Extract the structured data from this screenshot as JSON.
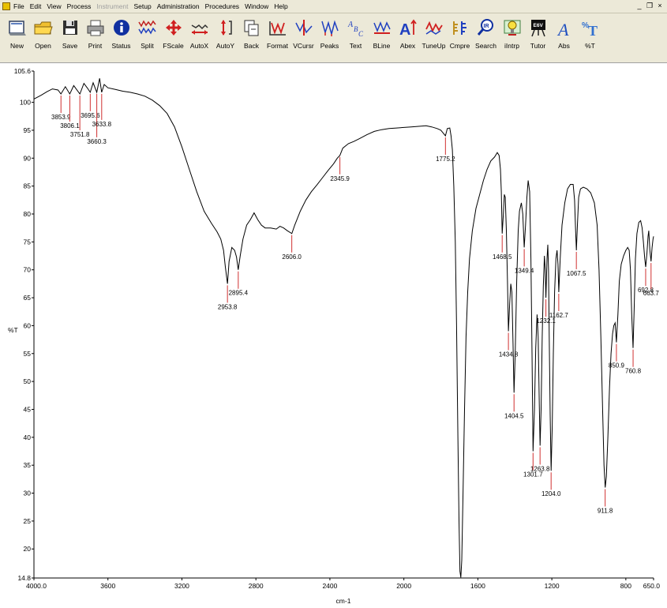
{
  "menubar": {
    "items": [
      {
        "label": "File",
        "enabled": true
      },
      {
        "label": "Edit",
        "enabled": true
      },
      {
        "label": "View",
        "enabled": true
      },
      {
        "label": "Process",
        "enabled": true
      },
      {
        "label": "Instrument",
        "enabled": false
      },
      {
        "label": "Setup",
        "enabled": true
      },
      {
        "label": "Administration",
        "enabled": true
      },
      {
        "label": "Procedures",
        "enabled": true
      },
      {
        "label": "Window",
        "enabled": true
      },
      {
        "label": "Help",
        "enabled": true
      }
    ],
    "window_controls": {
      "minimize": "_",
      "restore": "❐",
      "close": "×"
    }
  },
  "toolbar": {
    "buttons": [
      {
        "label": "New",
        "icon": "new-document-icon"
      },
      {
        "label": "Open",
        "icon": "open-folder-icon"
      },
      {
        "label": "Save",
        "icon": "floppy-disk-icon"
      },
      {
        "label": "Print",
        "icon": "printer-icon"
      },
      {
        "label": "Status",
        "icon": "info-icon"
      },
      {
        "label": "Split",
        "icon": "split-spectrum-icon"
      },
      {
        "label": "FScale",
        "icon": "full-scale-arrows-icon"
      },
      {
        "label": "AutoX",
        "icon": "auto-x-icon"
      },
      {
        "label": "AutoY",
        "icon": "auto-y-icon"
      },
      {
        "label": "Back",
        "icon": "back-pages-icon"
      },
      {
        "label": "Format",
        "icon": "format-icon"
      },
      {
        "label": "VCursr",
        "icon": "vertical-cursor-icon"
      },
      {
        "label": "Peaks",
        "icon": "peaks-icon"
      },
      {
        "label": "Text",
        "icon": "text-abc-icon"
      },
      {
        "label": "BLine",
        "icon": "baseline-icon"
      },
      {
        "label": "Abex",
        "icon": "abex-icon"
      },
      {
        "label": "TuneUp",
        "icon": "tune-up-icon"
      },
      {
        "label": "Cmpre",
        "icon": "compare-icon"
      },
      {
        "label": "Search",
        "icon": "search-ir-icon"
      },
      {
        "label": "iIntrp",
        "icon": "interpret-bulb-icon"
      },
      {
        "label": "Tutor",
        "icon": "tutor-easel-icon"
      },
      {
        "label": "Abs",
        "icon": "absorbance-icon"
      },
      {
        "label": "%T",
        "icon": "percent-transmittance-icon"
      }
    ],
    "tutor_icon_text": "E6V",
    "text_icon_glyphs": "ABC"
  },
  "chart_data": {
    "type": "line",
    "title": "",
    "xlabel": "cm-1",
    "ylabel": "%T",
    "xlim": [
      4000.0,
      650.0
    ],
    "ylim": [
      14.8,
      105.6
    ],
    "x_ticks": [
      "4000.0",
      "3600",
      "3200",
      "2800",
      "2400",
      "2000",
      "1600",
      "1200",
      "800",
      "650.0"
    ],
    "x_tick_values": [
      4000,
      3600,
      3200,
      2800,
      2400,
      2000,
      1600,
      1200,
      800,
      650
    ],
    "y_ticks": [
      "105.6",
      "100",
      "95",
      "90",
      "85",
      "80",
      "75",
      "70",
      "65",
      "60",
      "55",
      "50",
      "45",
      "40",
      "35",
      "30",
      "25",
      "20",
      "14.8"
    ],
    "y_tick_values": [
      105.6,
      100,
      95,
      90,
      85,
      80,
      75,
      70,
      65,
      60,
      55,
      50,
      45,
      40,
      35,
      30,
      25,
      20,
      14.8
    ],
    "grid": false,
    "colors": {
      "trace": "#000000",
      "peak_marker": "#d03030",
      "axis": "#000000"
    },
    "peak_labels": [
      {
        "x": 3853.9,
        "y": 101.5,
        "label": "3853.9",
        "level": 0
      },
      {
        "x": 3806.1,
        "y": 101.5,
        "label": "3806.1",
        "level": 1
      },
      {
        "x": 3751.8,
        "y": 101.5,
        "label": "3751.8",
        "level": 2
      },
      {
        "x": 3695.6,
        "y": 101.8,
        "label": "3695.6",
        "level": 0
      },
      {
        "x": 3660.3,
        "y": 101.8,
        "label": "3660.3",
        "level": 3
      },
      {
        "x": 3633.8,
        "y": 101.8,
        "label": "3633.8",
        "level": 1
      },
      {
        "x": 2953.8,
        "y": 67.5,
        "label": "2953.8",
        "level": 0
      },
      {
        "x": 2895.4,
        "y": 70.0,
        "label": "2895.4",
        "level": 0
      },
      {
        "x": 2606.0,
        "y": 76.5,
        "label": "2606.0",
        "level": 0
      },
      {
        "x": 2345.9,
        "y": 90.5,
        "label": "2345.9",
        "level": 0
      },
      {
        "x": 1775.2,
        "y": 94.0,
        "label": "1775.2",
        "level": 0
      },
      {
        "x": 1468.5,
        "y": 76.5,
        "label": "1468.5",
        "level": 0
      },
      {
        "x": 1434.8,
        "y": 59.0,
        "label": "1434.8",
        "level": 0
      },
      {
        "x": 1404.5,
        "y": 48.0,
        "label": "1404.5",
        "level": 0
      },
      {
        "x": 1349.4,
        "y": 74.0,
        "label": "1349.4",
        "level": 0
      },
      {
        "x": 1301.7,
        "y": 37.5,
        "label": "1301.7",
        "level": 0
      },
      {
        "x": 1263.8,
        "y": 38.5,
        "label": "1263.8",
        "level": 0
      },
      {
        "x": 1232.1,
        "y": 65.0,
        "label": "1232.1",
        "level": 0
      },
      {
        "x": 1204.0,
        "y": 34.0,
        "label": "1204.0",
        "level": 0
      },
      {
        "x": 1162.7,
        "y": 66.0,
        "label": "1162.7",
        "level": 0
      },
      {
        "x": 1067.5,
        "y": 73.5,
        "label": "1067.5",
        "level": 0
      },
      {
        "x": 911.8,
        "y": 31.0,
        "label": "911.8",
        "level": 0
      },
      {
        "x": 850.9,
        "y": 57.0,
        "label": "850.9",
        "level": 0
      },
      {
        "x": 760.8,
        "y": 56.0,
        "label": "760.8",
        "level": 0
      },
      {
        "x": 692.8,
        "y": 70.5,
        "label": "692.8",
        "level": 0
      },
      {
        "x": 663.7,
        "y": 71.5,
        "label": "663.7",
        "level": 1
      }
    ],
    "series": [
      {
        "values": [
          [
            4000,
            100.6
          ],
          [
            3960,
            101.3
          ],
          [
            3930,
            101.9
          ],
          [
            3900,
            102.4
          ],
          [
            3870,
            102.2
          ],
          [
            3853.9,
            101.5
          ],
          [
            3830,
            102.8
          ],
          [
            3806.1,
            101.5
          ],
          [
            3785,
            103.0
          ],
          [
            3751.8,
            101.5
          ],
          [
            3730,
            103.4
          ],
          [
            3710,
            102.5
          ],
          [
            3695.6,
            101.8
          ],
          [
            3680,
            103.5
          ],
          [
            3660.3,
            101.8
          ],
          [
            3645,
            104.3
          ],
          [
            3633.8,
            101.8
          ],
          [
            3620,
            103.2
          ],
          [
            3600,
            102.6
          ],
          [
            3560,
            102.3
          ],
          [
            3520,
            102.0
          ],
          [
            3480,
            101.8
          ],
          [
            3440,
            101.5
          ],
          [
            3400,
            101.1
          ],
          [
            3360,
            100.4
          ],
          [
            3320,
            99.4
          ],
          [
            3280,
            98.0
          ],
          [
            3240,
            95.6
          ],
          [
            3200,
            92.0
          ],
          [
            3160,
            88.0
          ],
          [
            3120,
            84.0
          ],
          [
            3080,
            80.5
          ],
          [
            3040,
            78.3
          ],
          [
            3010,
            76.8
          ],
          [
            2990,
            75.5
          ],
          [
            2975,
            73.5
          ],
          [
            2965,
            70.5
          ],
          [
            2953.8,
            67.5
          ],
          [
            2945,
            71.5
          ],
          [
            2930,
            74.0
          ],
          [
            2915,
            73.5
          ],
          [
            2905,
            72.3
          ],
          [
            2895.4,
            70.0
          ],
          [
            2885,
            72.5
          ],
          [
            2870,
            75.5
          ],
          [
            2850,
            78.0
          ],
          [
            2830,
            79.0
          ],
          [
            2810,
            80.2
          ],
          [
            2790,
            79.0
          ],
          [
            2770,
            78.0
          ],
          [
            2750,
            77.5
          ],
          [
            2720,
            77.5
          ],
          [
            2690,
            77.3
          ],
          [
            2670,
            77.8
          ],
          [
            2650,
            77.5
          ],
          [
            2630,
            77.0
          ],
          [
            2606.0,
            76.5
          ],
          [
            2590,
            78.0
          ],
          [
            2560,
            80.5
          ],
          [
            2530,
            82.5
          ],
          [
            2500,
            84.0
          ],
          [
            2470,
            85.2
          ],
          [
            2440,
            86.5
          ],
          [
            2410,
            87.8
          ],
          [
            2380,
            89.0
          ],
          [
            2360,
            90.0
          ],
          [
            2345.9,
            90.5
          ],
          [
            2330,
            91.8
          ],
          [
            2300,
            92.6
          ],
          [
            2270,
            93.0
          ],
          [
            2240,
            93.5
          ],
          [
            2200,
            94.2
          ],
          [
            2160,
            94.8
          ],
          [
            2120,
            95.1
          ],
          [
            2080,
            95.3
          ],
          [
            2040,
            95.4
          ],
          [
            2000,
            95.5
          ],
          [
            1960,
            95.6
          ],
          [
            1920,
            95.7
          ],
          [
            1880,
            95.8
          ],
          [
            1850,
            95.6
          ],
          [
            1820,
            95.3
          ],
          [
            1800,
            95.0
          ],
          [
            1790,
            94.6
          ],
          [
            1775.2,
            94.0
          ],
          [
            1765,
            95.3
          ],
          [
            1752,
            95.4
          ],
          [
            1745,
            94.0
          ],
          [
            1738,
            91.5
          ],
          [
            1730,
            85.0
          ],
          [
            1722,
            75.0
          ],
          [
            1715,
            60.0
          ],
          [
            1708,
            40.0
          ],
          [
            1702,
            25.0
          ],
          [
            1697,
            16.0
          ],
          [
            1692,
            14.9
          ],
          [
            1687,
            18.0
          ],
          [
            1680,
            30.0
          ],
          [
            1672,
            45.0
          ],
          [
            1664,
            58.0
          ],
          [
            1655,
            66.0
          ],
          [
            1645,
            72.0
          ],
          [
            1630,
            77.0
          ],
          [
            1610,
            81.0
          ],
          [
            1590,
            83.5
          ],
          [
            1570,
            86.0
          ],
          [
            1550,
            88.0
          ],
          [
            1530,
            89.5
          ],
          [
            1510,
            90.2
          ],
          [
            1495,
            91.0
          ],
          [
            1485,
            90.5
          ],
          [
            1478,
            88.0
          ],
          [
            1473,
            84.0
          ],
          [
            1468.5,
            76.5
          ],
          [
            1462,
            80.0
          ],
          [
            1457,
            83.5
          ],
          [
            1452,
            83.0
          ],
          [
            1446,
            77.0
          ],
          [
            1440,
            68.0
          ],
          [
            1434.8,
            59.0
          ],
          [
            1428,
            64.0
          ],
          [
            1422,
            67.5
          ],
          [
            1416,
            66.0
          ],
          [
            1410,
            57.0
          ],
          [
            1404.5,
            48.0
          ],
          [
            1398,
            55.0
          ],
          [
            1390,
            68.0
          ],
          [
            1382,
            77.0
          ],
          [
            1375,
            80.5
          ],
          [
            1365,
            82.0
          ],
          [
            1357,
            80.0
          ],
          [
            1349.4,
            74.0
          ],
          [
            1342,
            78.0
          ],
          [
            1335,
            83.0
          ],
          [
            1328,
            86.0
          ],
          [
            1320,
            84.0
          ],
          [
            1313,
            72.0
          ],
          [
            1307,
            55.0
          ],
          [
            1301.7,
            37.5
          ],
          [
            1294,
            45.0
          ],
          [
            1287,
            56.0
          ],
          [
            1280,
            62.0
          ],
          [
            1274,
            58.0
          ],
          [
            1268,
            46.0
          ],
          [
            1263.8,
            38.5
          ],
          [
            1258,
            45.0
          ],
          [
            1252,
            58.0
          ],
          [
            1246,
            67.0
          ],
          [
            1240,
            72.5
          ],
          [
            1236,
            70.0
          ],
          [
            1232.1,
            65.0
          ],
          [
            1226,
            72.0
          ],
          [
            1222,
            74.5
          ],
          [
            1218,
            70.0
          ],
          [
            1214,
            58.0
          ],
          [
            1209,
            44.0
          ],
          [
            1204.0,
            34.0
          ],
          [
            1198,
            42.0
          ],
          [
            1192,
            55.0
          ],
          [
            1185,
            66.0
          ],
          [
            1178,
            72.0
          ],
          [
            1172,
            73.5
          ],
          [
            1167,
            71.0
          ],
          [
            1162.7,
            66.0
          ],
          [
            1155,
            72.0
          ],
          [
            1145,
            78.0
          ],
          [
            1130,
            82.0
          ],
          [
            1115,
            84.5
          ],
          [
            1100,
            85.3
          ],
          [
            1085,
            85.3
          ],
          [
            1077,
            82.5
          ],
          [
            1072,
            77.5
          ],
          [
            1067.5,
            73.5
          ],
          [
            1062,
            78.0
          ],
          [
            1055,
            83.0
          ],
          [
            1045,
            84.5
          ],
          [
            1030,
            84.8
          ],
          [
            1010,
            84.5
          ],
          [
            990,
            83.8
          ],
          [
            970,
            82.0
          ],
          [
            955,
            78.0
          ],
          [
            945,
            70.0
          ],
          [
            935,
            58.0
          ],
          [
            925,
            44.0
          ],
          [
            918,
            35.0
          ],
          [
            911.8,
            31.0
          ],
          [
            905,
            33.0
          ],
          [
            897,
            40.0
          ],
          [
            888,
            49.0
          ],
          [
            880,
            55.0
          ],
          [
            872,
            58.5
          ],
          [
            865,
            60.0
          ],
          [
            858,
            60.5
          ],
          [
            850.9,
            57.0
          ],
          [
            843,
            62.0
          ],
          [
            835,
            68.0
          ],
          [
            825,
            71.0
          ],
          [
            812,
            72.5
          ],
          [
            800,
            73.5
          ],
          [
            790,
            74.0
          ],
          [
            782,
            73.5
          ],
          [
            775,
            70.0
          ],
          [
            768,
            62.0
          ],
          [
            760.8,
            56.0
          ],
          [
            755,
            63.0
          ],
          [
            748,
            72.0
          ],
          [
            740,
            76.5
          ],
          [
            730,
            78.5
          ],
          [
            720,
            78.8
          ],
          [
            712,
            77.5
          ],
          [
            705,
            75.0
          ],
          [
            698,
            72.0
          ],
          [
            692.8,
            70.5
          ],
          [
            686,
            73.0
          ],
          [
            680,
            76.0
          ],
          [
            676,
            77.0
          ],
          [
            670,
            73.5
          ],
          [
            663.7,
            71.5
          ],
          [
            658,
            74.0
          ],
          [
            653,
            75.5
          ],
          [
            650,
            76.0
          ]
        ]
      }
    ]
  }
}
